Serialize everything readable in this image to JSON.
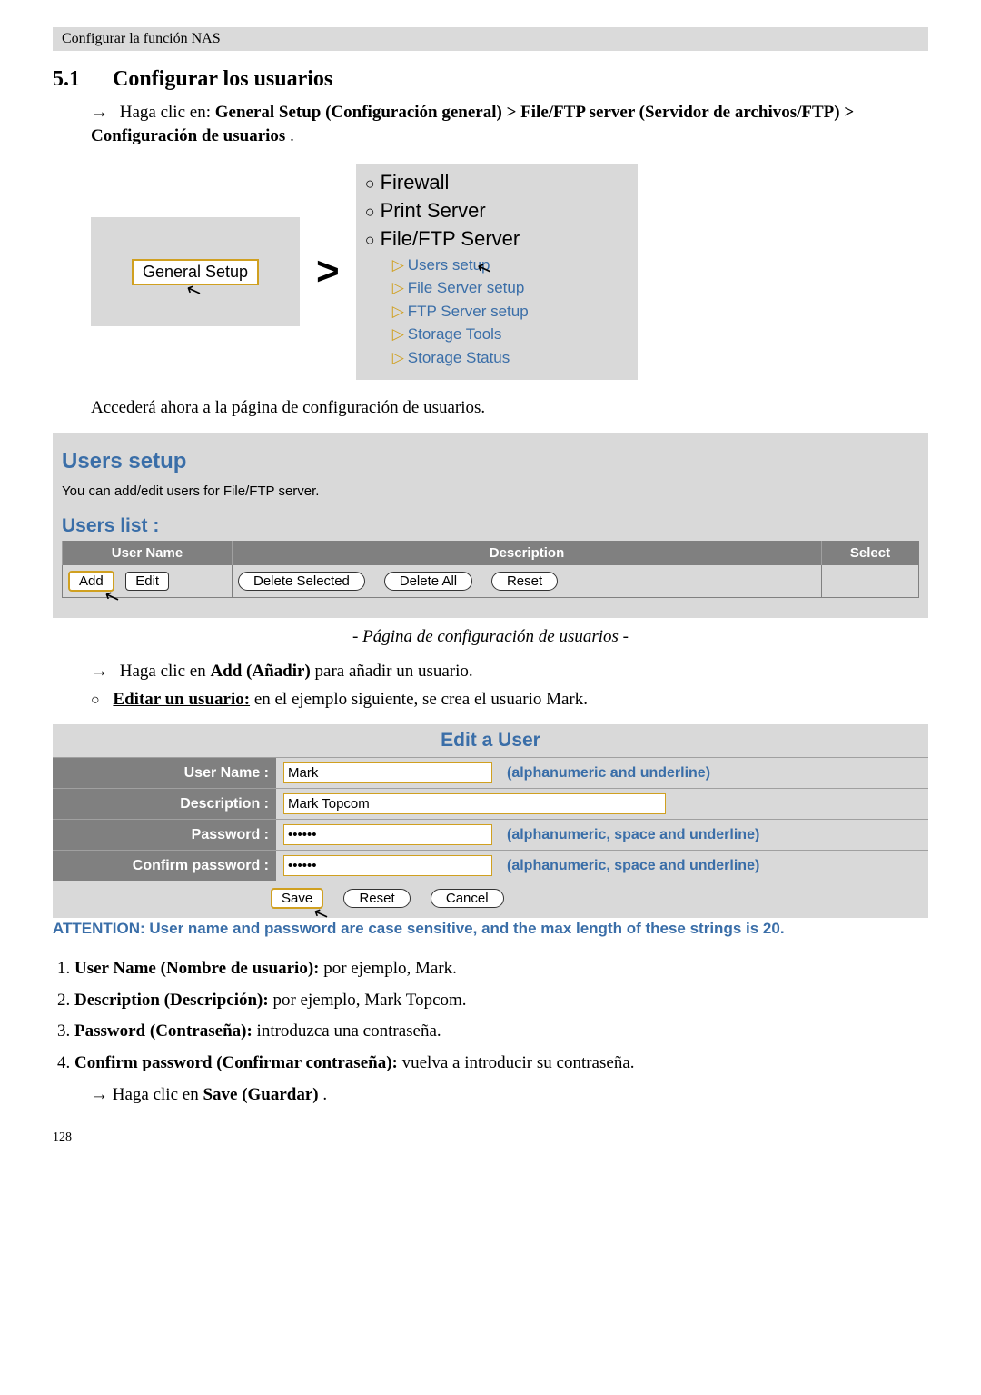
{
  "runhead": "Configurar la función NAS",
  "section": {
    "num": "5.1",
    "title": "Configurar los usuarios"
  },
  "p_nav_prefix": "Haga clic en: ",
  "p_nav_bold": "General Setup (Configuración general) > File/FTP server (Servidor de archivos/FTP) > Configuración de usuarios",
  "p_nav_suffix": ".",
  "fig": {
    "general_setup_btn": "General Setup",
    "gt": ">",
    "menu": {
      "firewall": "Firewall",
      "print": "Print Server",
      "fileftp": "File/FTP Server",
      "subs": [
        "Users setup",
        "File Server setup",
        "FTP Server setup",
        "Storage Tools",
        "Storage Status"
      ]
    }
  },
  "p_accedera": "Accederá ahora a la página de configuración de usuarios.",
  "users_setup": {
    "title": "Users setup",
    "sub": "You can add/edit users for File/FTP server.",
    "list_title": "Users list  :",
    "cols": {
      "name": "User Name",
      "desc": "Description",
      "select": "Select"
    },
    "buttons": {
      "add": "Add",
      "edit": "Edit",
      "del_sel": "Delete Selected",
      "del_all": "Delete All",
      "reset": "Reset"
    }
  },
  "caption_users": "- Página de configuración de usuarios -",
  "p_add_prefix": "Haga clic en ",
  "p_add_bold": "Add (Añadir)",
  "p_add_suffix": " para añadir un usuario.",
  "p_edit_user_bold": "Editar un usuario:",
  "p_edit_user_rest": " en el ejemplo siguiente, se crea el usuario Mark.",
  "edit": {
    "title": "Edit a User",
    "rows": {
      "uname": {
        "lbl": "User Name :",
        "val": "Mark",
        "hint": "(alphanumeric and underline)"
      },
      "desc": {
        "lbl": "Description :",
        "val": "Mark Topcom",
        "hint": ""
      },
      "pwd": {
        "lbl": "Password :",
        "val": "••••••",
        "hint": "(alphanumeric, space and underline)"
      },
      "cpwd": {
        "lbl": "Confirm password :",
        "val": "••••••",
        "hint": "(alphanumeric, space and underline)"
      }
    },
    "buttons": {
      "save": "Save",
      "reset": "Reset",
      "cancel": "Cancel"
    },
    "attn": "ATTENTION: User name and password are case sensitive, and the max length of these strings is 20."
  },
  "fields": [
    {
      "b": "User Name (Nombre de usuario):",
      "r": " por ejemplo, Mark."
    },
    {
      "b": "Description (Descripción):",
      "r": " por ejemplo, Mark Topcom."
    },
    {
      "b": "Password (Contraseña):",
      "r": " introduzca una contraseña."
    },
    {
      "b": "Confirm password (Confirmar contraseña):",
      "r": " vuelva a introducir su contraseña."
    }
  ],
  "p_save_prefix": "Haga clic en ",
  "p_save_bold": "Save (Guardar)",
  "p_save_suffix": ".",
  "page_number": "128"
}
